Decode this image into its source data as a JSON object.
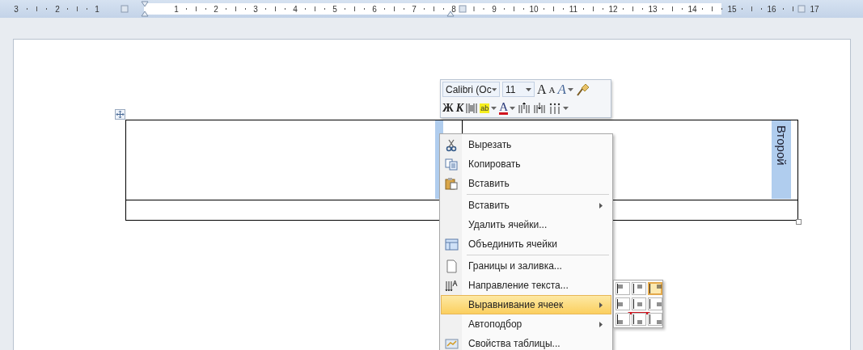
{
  "ruler": {
    "numbers": [
      "3",
      "2",
      "1",
      "1",
      "2",
      "3",
      "4",
      "5",
      "6",
      "7",
      "8",
      "9",
      "10",
      "11",
      "12",
      "13",
      "14",
      "15",
      "16",
      "17"
    ]
  },
  "table": {
    "rows": [
      {
        "cells": [
          {
            "selected": true
          },
          {
            "text": "Второй",
            "selected": true
          }
        ]
      },
      {
        "cells": [
          {
            "selected": false
          },
          {
            "selected": false
          }
        ]
      }
    ]
  },
  "mini_toolbar": {
    "font": "Calibri (Oc",
    "size": "11",
    "row1": [
      {
        "kind": "grow",
        "label": "A"
      },
      {
        "kind": "shrink",
        "label": "A"
      },
      {
        "kind": "styles",
        "label": "A"
      },
      {
        "kind": "painter"
      }
    ],
    "row2": [
      {
        "kind": "bold",
        "label": "Ж"
      },
      {
        "kind": "italic",
        "label": "К"
      },
      {
        "kind": "center"
      },
      {
        "kind": "highlight",
        "label": "ab"
      },
      {
        "kind": "fontcolor",
        "label": "A"
      },
      {
        "kind": "indent"
      },
      {
        "kind": "outdent"
      },
      {
        "kind": "bullets"
      }
    ]
  },
  "context_menu": {
    "items": [
      {
        "label": "Вырезать",
        "submenu": false,
        "selected": false,
        "separator_before": false
      },
      {
        "label": "Копировать",
        "submenu": false,
        "selected": false,
        "separator_before": false
      },
      {
        "label": "Вставить",
        "submenu": false,
        "selected": false,
        "separator_before": false
      },
      {
        "label": "Вставить",
        "submenu": true,
        "selected": false,
        "separator_before": true
      },
      {
        "label": "Удалить ячейки...",
        "submenu": false,
        "selected": false,
        "separator_before": false
      },
      {
        "label": "Объединить ячейки",
        "submenu": false,
        "selected": false,
        "separator_before": false
      },
      {
        "label": "Границы и заливка...",
        "submenu": false,
        "selected": false,
        "separator_before": true
      },
      {
        "label": "Направление текста...",
        "submenu": false,
        "selected": false,
        "separator_before": false
      },
      {
        "label": "Выравнивание ячеек",
        "submenu": true,
        "selected": true,
        "separator_before": false
      },
      {
        "label": "Автоподбор",
        "submenu": true,
        "selected": false,
        "separator_before": false
      },
      {
        "label": "Свойства таблицы...",
        "submenu": false,
        "selected": false,
        "separator_before": false
      }
    ]
  },
  "alignment_submenu": {
    "buttons": [
      {
        "selected": false
      },
      {
        "selected": false
      },
      {
        "selected": true
      },
      {
        "selected": false
      },
      {
        "selected": false,
        "marked": true
      },
      {
        "selected": false
      },
      {
        "selected": false
      },
      {
        "selected": false
      },
      {
        "selected": false
      }
    ]
  }
}
